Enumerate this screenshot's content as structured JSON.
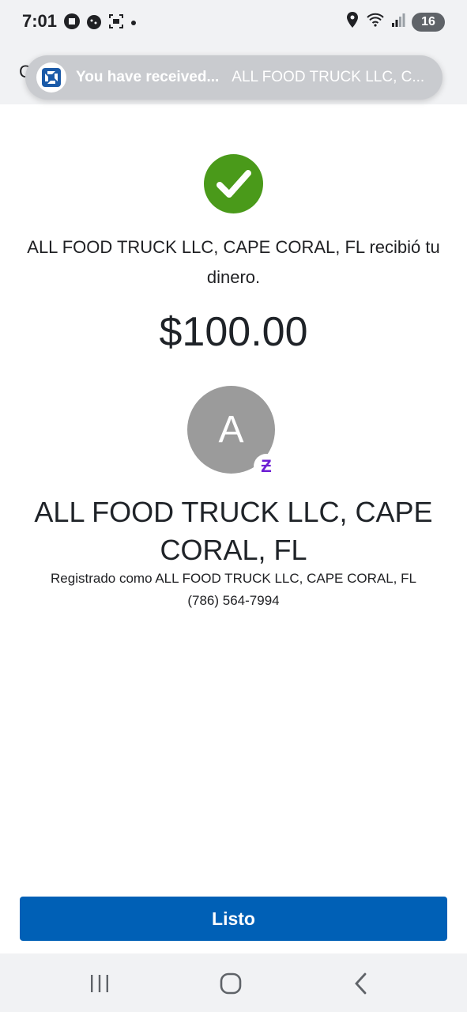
{
  "status_bar": {
    "time": "7:01",
    "battery": "16",
    "icons": [
      "app-notification-icon",
      "app-notification-icon",
      "screenshot-icon",
      "dot-icon",
      "location-icon",
      "wifi-icon",
      "signal-icon"
    ]
  },
  "header": {
    "peek_letter": "C"
  },
  "notification": {
    "title": "You have received...",
    "body": "ALL FOOD TRUCK LLC, C...",
    "icon": "chase-logo-icon",
    "brand_color": "#1a5aa8"
  },
  "confirmation": {
    "message": "ALL FOOD TRUCK LLC, CAPE CORAL, FL recibió tu dinero.",
    "amount": "$100.00",
    "success_color": "#4a9a1a"
  },
  "recipient": {
    "avatar_initial": "A",
    "badge_symbol": "Ƶ",
    "badge_icon": "zelle-icon",
    "name": "ALL FOOD TRUCK LLC, CAPE CORAL, FL",
    "registered_as": "Registrado como ALL FOOD TRUCK LLC, CAPE CORAL, FL",
    "phone": "(786) 564-7994"
  },
  "actions": {
    "done_label": "Listo",
    "button_color": "#0060b6"
  },
  "nav": {
    "icons": [
      "recent-apps-icon",
      "home-icon",
      "back-icon"
    ]
  }
}
